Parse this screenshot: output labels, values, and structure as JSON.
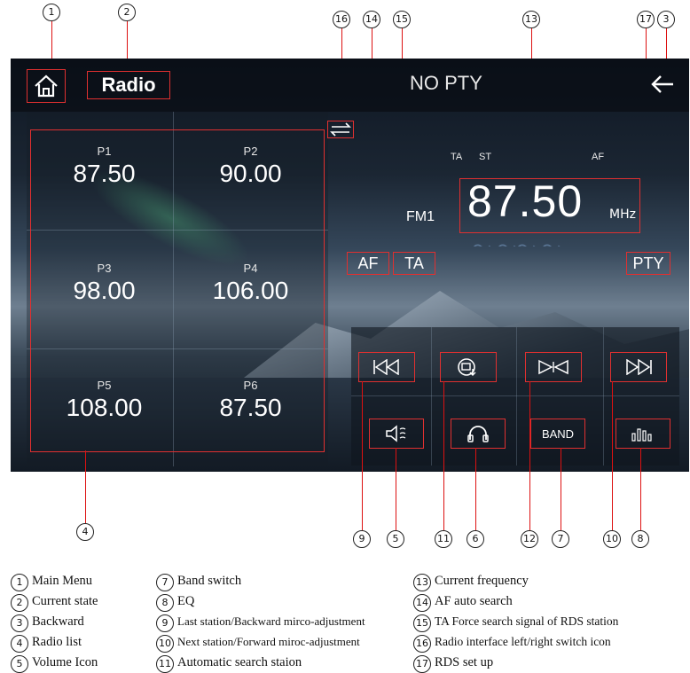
{
  "callouts": {
    "c1": "1",
    "c2": "2",
    "c3": "3",
    "c4": "4",
    "c5": "5",
    "c6": "6",
    "c7": "7",
    "c8": "8",
    "c9": "9",
    "c10": "10",
    "c11": "11",
    "c12": "12",
    "c13": "13",
    "c14": "14",
    "c15": "15",
    "c16": "16",
    "c17": "17"
  },
  "header": {
    "title": "Radio",
    "pty_status": "NO PTY",
    "home_icon": "home-icon",
    "back_icon": "arrow-left-icon"
  },
  "presets": [
    {
      "label": "P1",
      "freq": "87.50"
    },
    {
      "label": "P2",
      "freq": "90.00"
    },
    {
      "label": "P3",
      "freq": "98.00"
    },
    {
      "label": "P4",
      "freq": "106.00"
    },
    {
      "label": "P5",
      "freq": "108.00"
    },
    {
      "label": "P6",
      "freq": "87.50"
    }
  ],
  "tuner": {
    "ta_indicator": "TA",
    "st_indicator": "ST",
    "af_indicator": "AF",
    "band": "FM1",
    "frequency": "87.50",
    "unit": "MHz",
    "af_button": "AF",
    "ta_button": "TA",
    "pty_button": "PTY"
  },
  "controls": {
    "band_label": "BAND"
  },
  "legend": [
    {
      "n": "1",
      "text": "Main Menu"
    },
    {
      "n": "2",
      "text": "Current state"
    },
    {
      "n": "3",
      "text": "Backward"
    },
    {
      "n": "4",
      "text": "Radio list"
    },
    {
      "n": "5",
      "text": "Volume Icon"
    },
    {
      "n": "7",
      "text": "Band switch"
    },
    {
      "n": "8",
      "text": "EQ"
    },
    {
      "n": "9",
      "text": "Last station/Backward mirco-adjustment"
    },
    {
      "n": "10",
      "text": "Next station/Forward miroc-adjustment"
    },
    {
      "n": "11",
      "text": "Automatic search staion"
    },
    {
      "n": "13",
      "text": "Current frequency"
    },
    {
      "n": "14",
      "text": "AF auto search"
    },
    {
      "n": "15",
      "text": "TA Force search signal of RDS station"
    },
    {
      "n": "16",
      "text": "Radio interface left/right switch icon"
    },
    {
      "n": "17",
      "text": "RDS set up"
    }
  ],
  "colors": {
    "highlight": "#e03030",
    "background": "#ffffff"
  }
}
